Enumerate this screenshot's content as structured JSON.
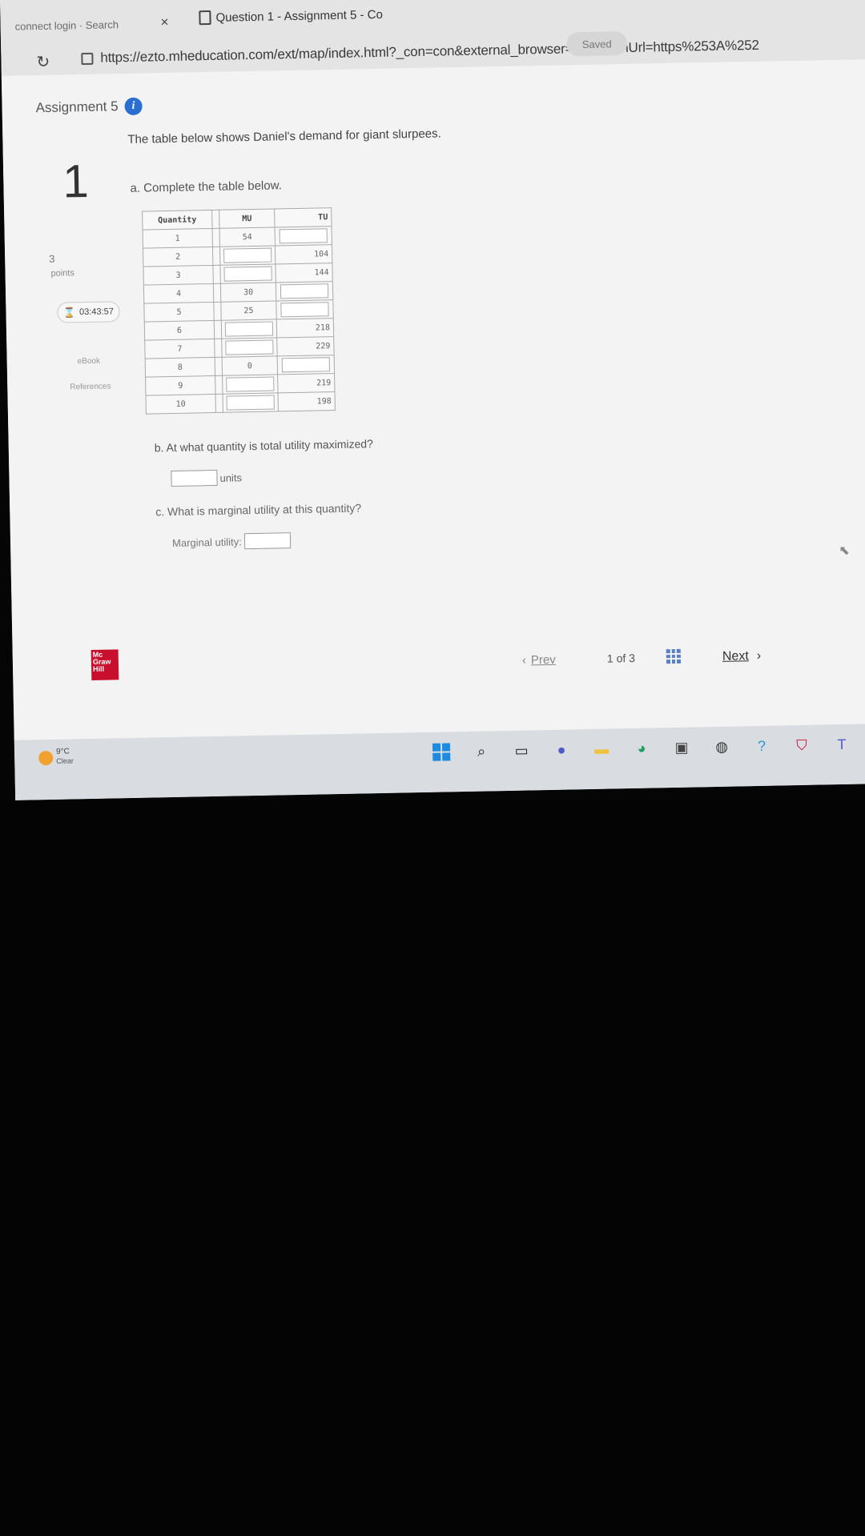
{
  "browser": {
    "prev_tab": "connect login · Search",
    "active_tab_title": "Question 1 - Assignment 5 - Co",
    "url": "https://ezto.mheducation.com/ext/map/index.html?_con=con&external_browser=0&launchUrl=https%253A%252",
    "saved_label": "Saved"
  },
  "assignment": {
    "title": "Assignment 5",
    "question_number": "1",
    "points_value": "3",
    "points_label": "points",
    "timer": "03:43:57",
    "ebook_label": "eBook",
    "references_label": "References"
  },
  "question": {
    "prompt": "The table below shows Daniel's demand for giant slurpees.",
    "part_a": "a. Complete the table below.",
    "table": {
      "headers": {
        "quantity": "Quantity",
        "mu": "MU",
        "tu": "TU"
      },
      "rows": [
        {
          "q": "1",
          "mu": "54",
          "tu": ""
        },
        {
          "q": "2",
          "mu": "",
          "tu": "104"
        },
        {
          "q": "3",
          "mu": "",
          "tu": "144"
        },
        {
          "q": "4",
          "mu": "30",
          "tu": ""
        },
        {
          "q": "5",
          "mu": "25",
          "tu": ""
        },
        {
          "q": "6",
          "mu": "",
          "tu": "218"
        },
        {
          "q": "7",
          "mu": "",
          "tu": "229"
        },
        {
          "q": "8",
          "mu": "0",
          "tu": ""
        },
        {
          "q": "9",
          "mu": "",
          "tu": "219"
        },
        {
          "q": "10",
          "mu": "",
          "tu": "198"
        }
      ]
    },
    "part_b": "b. At what quantity is total utility maximized?",
    "units_label": "units",
    "part_c": "c. What is marginal utility at this quantity?",
    "mu_label": "Marginal utility:"
  },
  "navigation": {
    "prev": "Prev",
    "page_current": "1",
    "page_of": "of",
    "page_total": "3",
    "next": "Next"
  },
  "logo": {
    "line1": "Mc",
    "line2": "Graw",
    "line3": "Hill"
  },
  "taskbar": {
    "temperature": "9°C",
    "condition": "Clear"
  },
  "colors": {
    "accent": "#2a6fd0",
    "logo": "#c8102e",
    "taskbar": "#d9dde2"
  }
}
